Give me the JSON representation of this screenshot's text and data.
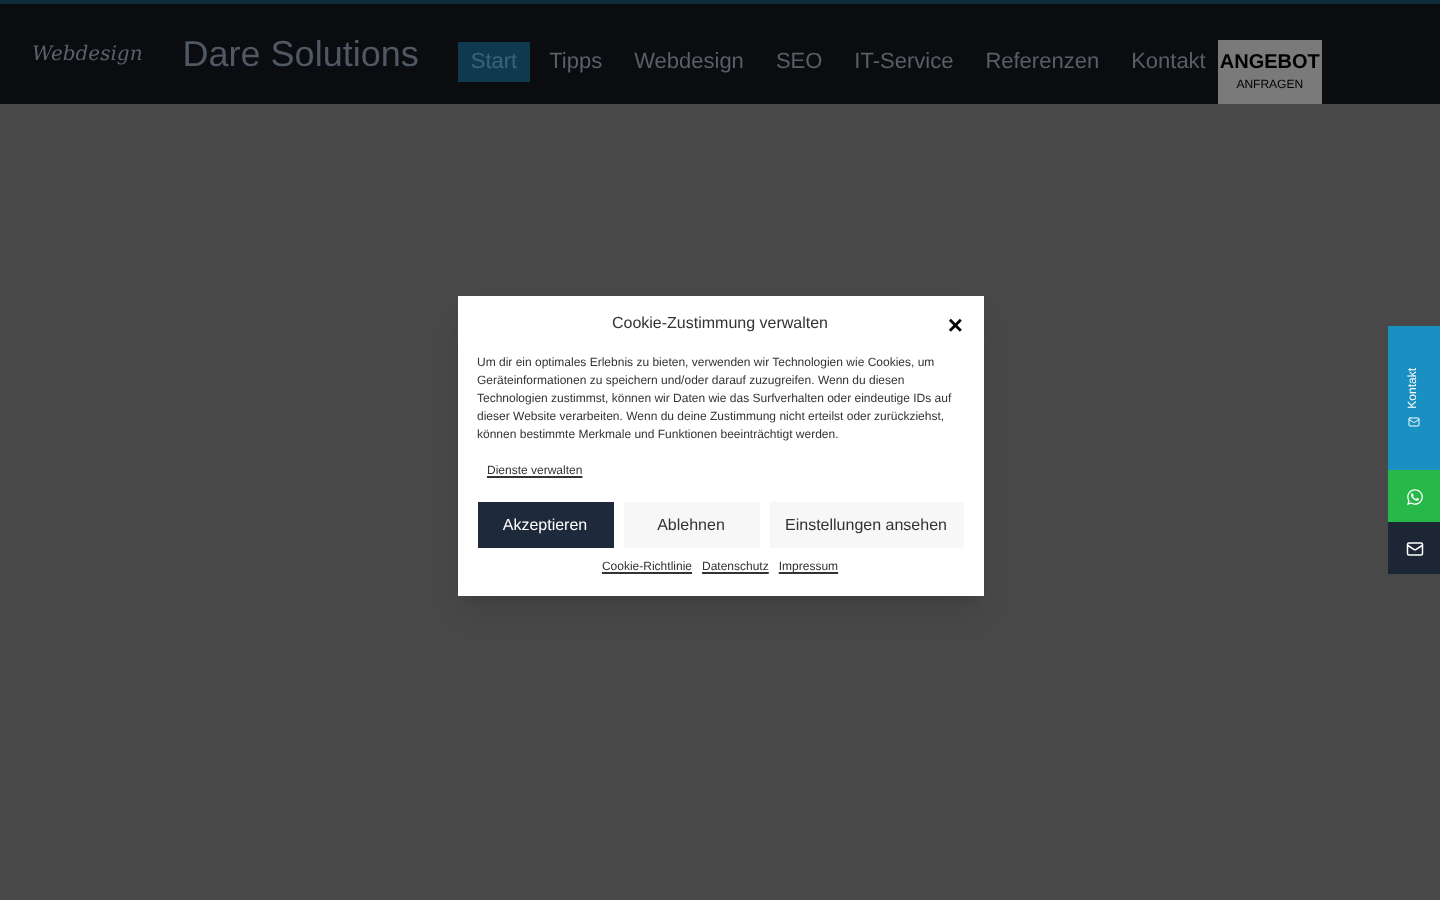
{
  "header": {
    "script_logo": "Webdesign",
    "brand": "Dare Solutions",
    "nav": [
      {
        "label": "Start",
        "selected": true
      },
      {
        "label": "Tipps",
        "selected": false
      },
      {
        "label": "Webdesign",
        "selected": false
      },
      {
        "label": "SEO",
        "selected": false
      },
      {
        "label": "IT-Service",
        "selected": false
      },
      {
        "label": "Referenzen",
        "selected": false
      },
      {
        "label": "Kontakt",
        "selected": false
      }
    ],
    "cta": {
      "title": "ANGEBOT",
      "subtitle": "ANFRAGEN"
    }
  },
  "cookie_dialog": {
    "title": "Cookie-Zustimmung verwalten",
    "close": "×",
    "text": "Um dir ein optimales Erlebnis zu bieten, verwenden wir Technologien wie Cookies, um Geräteinformationen zu speichern und/oder darauf zuzugreifen. Wenn du diesen Technologien zustimmst, können wir Daten wie das Surfverhalten oder eindeutige IDs auf dieser Website verarbeiten. Wenn du deine Zustimmung nicht erteilst oder zurückziehst, können bestimmte Merkmale und Funktionen beeinträchtigt werden.",
    "manage_link": "Dienste verwalten",
    "buttons": [
      {
        "label": "Akzeptieren",
        "kind": "primary"
      },
      {
        "label": "Ablehnen",
        "kind": "secondary"
      },
      {
        "label": "Einstellungen ansehen",
        "kind": "secondary"
      }
    ],
    "footer_links": [
      "Cookie-Richtlinie",
      "Datenschutz",
      "Impressum"
    ]
  },
  "side_tabs": [
    {
      "kind": "contact",
      "label": "Kontakt"
    },
    {
      "kind": "whatsapp"
    },
    {
      "kind": "mail"
    }
  ]
}
